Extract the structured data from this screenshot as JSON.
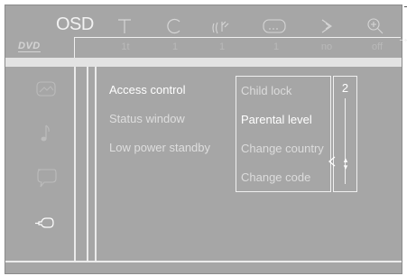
{
  "top_bar": {
    "osd_label": "OSD",
    "icons": [
      "text-t-icon",
      "channel-c-icon",
      "audio-icon",
      "subtitle-icon",
      "angle-icon",
      "zoom-icon"
    ],
    "disc_logo": "DVD",
    "status_values": [
      "1t",
      "1",
      "1",
      "1",
      "no",
      "off"
    ]
  },
  "sidebar": {
    "icons": [
      "picture-icon",
      "sound-icon",
      "language-icon",
      "features-icon"
    ]
  },
  "menu": {
    "items": [
      "Access control",
      "Status window",
      "Low power standby"
    ]
  },
  "submenu": {
    "items": [
      "Child lock",
      "Parental level",
      "Change country",
      "Change code"
    ]
  },
  "value_box": {
    "value": "2"
  }
}
